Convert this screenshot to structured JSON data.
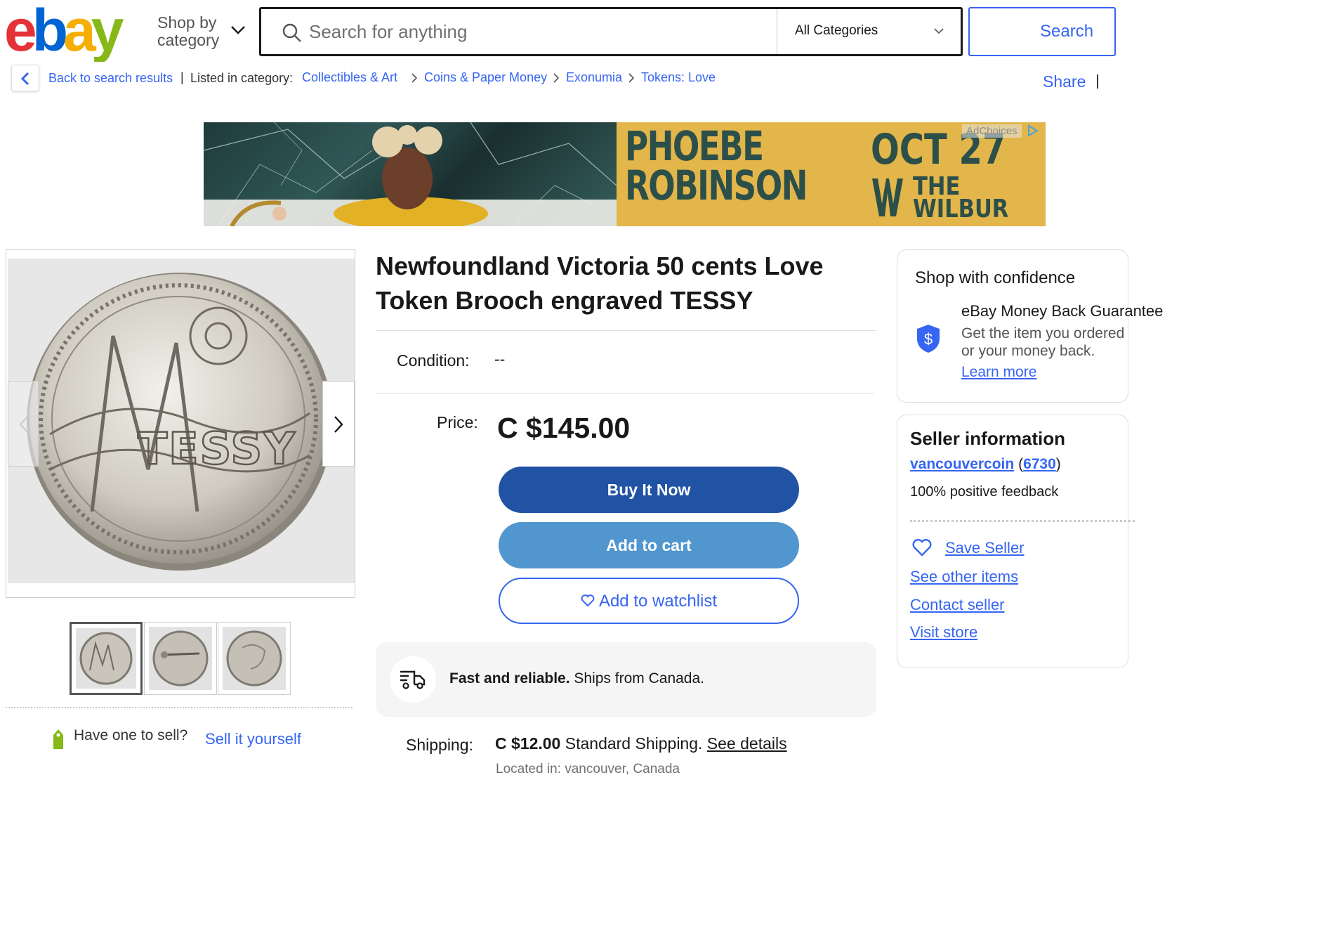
{
  "header": {
    "shop_by_category": "Shop by category",
    "search_placeholder": "Search for anything",
    "category_select": "All Categories",
    "search_button": "Search"
  },
  "breadcrumb": {
    "back": "Back to search results",
    "separator": "|",
    "listed_in": "Listed in category:",
    "items": [
      "Collectibles & Art",
      "Coins & Paper Money",
      "Exonumia",
      "Tokens: Love"
    ],
    "share": "Share"
  },
  "ad": {
    "name_line1": "PHOEBE",
    "name_line2": "ROBINSON",
    "date": "OCT 27",
    "venue_line1": "THE",
    "venue_line2": "WILBUR",
    "adchoices": "AdChoices"
  },
  "item": {
    "title": "Newfoundland Victoria 50 cents Love Token Brooch engraved TESSY",
    "condition_label": "Condition:",
    "condition_value": "--",
    "price_label": "Price:",
    "price": "C $145.00",
    "buy_now": "Buy It Now",
    "add_to_cart": "Add to cart",
    "add_to_watchlist": "Add to watchlist",
    "fast_bold": "Fast and reliable.",
    "fast_rest": " Ships from Canada.",
    "shipping_label": "Shipping:",
    "shipping_price": "C $12.00",
    "shipping_method": " Standard Shipping. ",
    "see_details": "See details",
    "located": "Located in: vancouver, Canada"
  },
  "gallery": {
    "engraving": "TESSY",
    "thumbnail_count": 3,
    "active_thumbnail": 1
  },
  "sell": {
    "have_one": "Have one to sell?",
    "sell_it": "Sell it yourself"
  },
  "confidence": {
    "title": "Shop with confidence",
    "money_back_title": "eBay Money Back Guarantee",
    "money_back_desc": "Get the item you ordered or your money back.",
    "learn_more": "Learn more"
  },
  "seller": {
    "title": "Seller information",
    "name": "vancouvercoin",
    "open_paren": " (",
    "count": "6730",
    "close_paren": ")",
    "feedback": "100% positive feedback",
    "save_seller": "Save Seller",
    "see_other": "See other items",
    "contact": "Contact seller",
    "visit_store": "Visit store"
  },
  "colors": {
    "link": "#3665f3",
    "buy_now_bg": "#2153a5",
    "add_to_cart_bg": "#5196cf",
    "ebay_e": "#e53238",
    "ebay_b": "#0064d2",
    "ebay_a": "#f5af02",
    "ebay_y": "#86b817"
  }
}
